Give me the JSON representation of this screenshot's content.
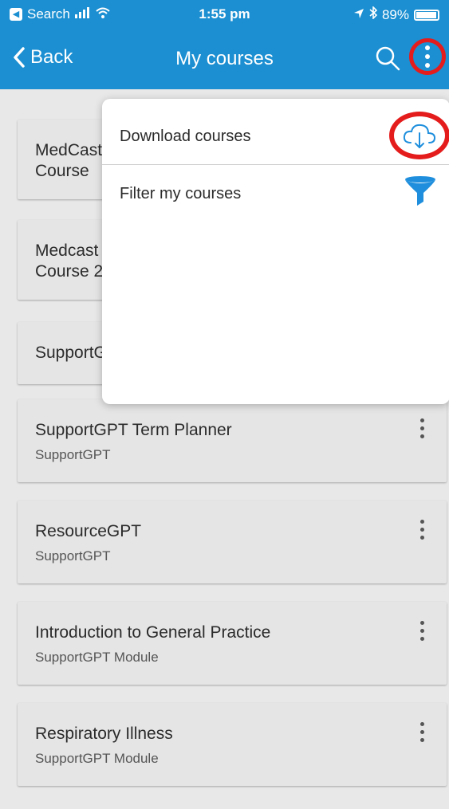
{
  "status_bar": {
    "carrier": "Search",
    "time": "1:55 pm",
    "battery": "89%"
  },
  "navbar": {
    "back_label": "Back",
    "title": "My courses"
  },
  "menu": {
    "items": [
      {
        "label": "Download courses",
        "icon": "cloud-download-icon"
      },
      {
        "label": "Filter my courses",
        "icon": "funnel-icon"
      }
    ]
  },
  "courses": [
    {
      "title_line1": "MedCast",
      "title_line2": "Course",
      "subtitle": ""
    },
    {
      "title_line1": "Medcast",
      "title_line2": "Course 2",
      "subtitle": ""
    },
    {
      "title_line1": "SupportGPT",
      "title_line2": "",
      "subtitle": ""
    },
    {
      "title_line1": "SupportGPT Term Planner",
      "title_line2": "",
      "subtitle": "SupportGPT"
    },
    {
      "title_line1": "ResourceGPT",
      "title_line2": "",
      "subtitle": "SupportGPT"
    },
    {
      "title_line1": "Introduction to General Practice",
      "title_line2": "",
      "subtitle": "SupportGPT Module"
    },
    {
      "title_line1": "Respiratory Illness",
      "title_line2": "",
      "subtitle": "SupportGPT Module"
    }
  ],
  "colors": {
    "brand": "#1b8fd1",
    "highlight": "#e41c1c",
    "icon_blue": "#1f8fdd"
  }
}
